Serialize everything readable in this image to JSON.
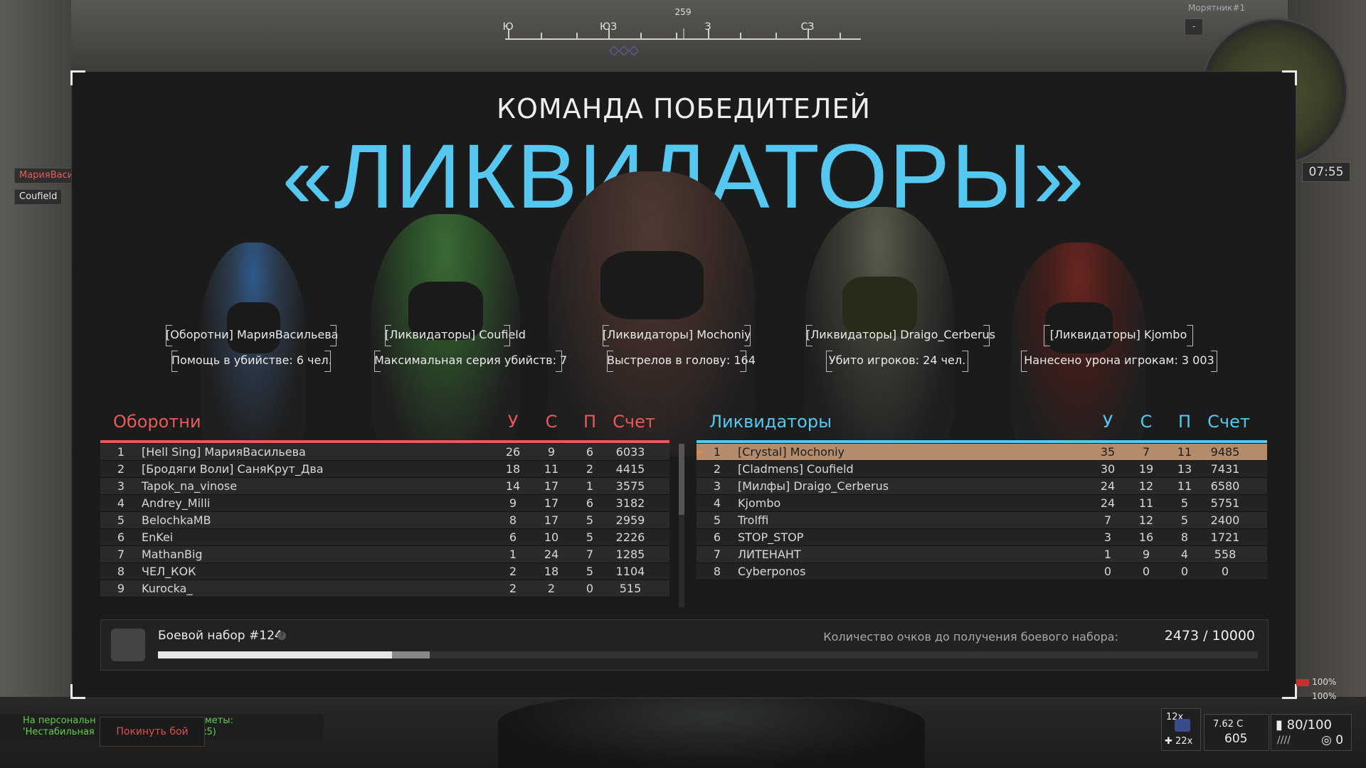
{
  "compass": {
    "labels": [
      "Ю",
      "ЮЗ",
      "З",
      "СЗ"
    ],
    "heading": "259"
  },
  "minimap": {
    "player": "Морятник#1",
    "btn": "-"
  },
  "timer": "07:55",
  "left_tags": [
    "МарияВаси",
    "Coufield"
  ],
  "winner": {
    "subtitle": "КОМАНДА ПОБЕДИТЕЛЕЙ",
    "name": "«ЛИКВИДАТОРЫ»"
  },
  "mvps": [
    {
      "name": "[Оборотни] МарияВасильева",
      "award": "Помощь в убийстве: 6 чел."
    },
    {
      "name": "[Ликвидаторы] Coufield",
      "award": "Максимальная серия убийств: 7"
    },
    {
      "name": "[Ликвидаторы] Mochoniy",
      "award": "Выстрелов в голову: 164"
    },
    {
      "name": "[Ликвидаторы] Draigo_Cerberus",
      "award": "Убито игроков: 24 чел."
    },
    {
      "name": "[Ликвидаторы] Kjombo",
      "award": "Нанесено урона игрокам: 3 003"
    }
  ],
  "headers": {
    "u": "У",
    "s": "С",
    "p": "П",
    "score": "Счет"
  },
  "team_left": {
    "name": "Оборотни",
    "color": "#e85a5a",
    "rows": [
      {
        "n": "1",
        "name": "[Hell Sing] МарияВасильева",
        "u": "26",
        "s": "9",
        "p": "6",
        "score": "6033"
      },
      {
        "n": "2",
        "name": "[Бродяги Воли] СаняКрут_Два",
        "u": "18",
        "s": "11",
        "p": "2",
        "score": "4415"
      },
      {
        "n": "3",
        "name": "Tapok_na_vinose",
        "u": "14",
        "s": "17",
        "p": "1",
        "score": "3575"
      },
      {
        "n": "4",
        "name": "Andrey_Milli",
        "u": "9",
        "s": "17",
        "p": "6",
        "score": "3182"
      },
      {
        "n": "5",
        "name": "BelochkaMB",
        "u": "8",
        "s": "17",
        "p": "5",
        "score": "2959"
      },
      {
        "n": "6",
        "name": "EnKei",
        "u": "6",
        "s": "10",
        "p": "5",
        "score": "2226"
      },
      {
        "n": "7",
        "name": "MathanBig",
        "u": "1",
        "s": "24",
        "p": "7",
        "score": "1285"
      },
      {
        "n": "8",
        "name": "ЧЕЛ_КОК",
        "u": "2",
        "s": "18",
        "p": "5",
        "score": "1104"
      },
      {
        "n": "9",
        "name": "Kurocka_",
        "u": "2",
        "s": "2",
        "p": "0",
        "score": "515"
      }
    ]
  },
  "team_right": {
    "name": "Ликвидаторы",
    "color": "#56c8f0",
    "rows": [
      {
        "n": "1",
        "name": "[Crystal] Mochoniy",
        "u": "35",
        "s": "7",
        "p": "11",
        "score": "9485"
      },
      {
        "n": "2",
        "name": "[Cladmens] Coufield",
        "u": "30",
        "s": "19",
        "p": "13",
        "score": "7431"
      },
      {
        "n": "3",
        "name": "[Милфы] Draigo_Cerberus",
        "u": "24",
        "s": "12",
        "p": "11",
        "score": "6580"
      },
      {
        "n": "4",
        "name": "Kjombo",
        "u": "24",
        "s": "11",
        "p": "5",
        "score": "5751"
      },
      {
        "n": "5",
        "name": "Trolffi",
        "u": "7",
        "s": "12",
        "p": "5",
        "score": "2400"
      },
      {
        "n": "6",
        "name": "STOP_STOP",
        "u": "3",
        "s": "16",
        "p": "8",
        "score": "1721"
      },
      {
        "n": "7",
        "name": "ЛИТЕНАНТ",
        "u": "1",
        "s": "9",
        "p": "4",
        "score": "558"
      },
      {
        "n": "8",
        "name": "Cyberponos",
        "u": "0",
        "s": "0",
        "p": "0",
        "score": "0"
      }
    ]
  },
  "kit": {
    "title": "Боевой набор #124",
    "info_icon": "?",
    "label": "Количество очков до получения боевого набора:",
    "value": "2473 / 10000",
    "progress": 0.2473
  },
  "chat": {
    "line1": "На персональн",
    "line1b": "редметы:",
    "line2": "'Нестабильная",
    "line2b": "x5)"
  },
  "leave_button": "Покинуть бой",
  "hud": {
    "armor": "100%",
    "health": "100%",
    "grenades_top": "12x",
    "grenades_bottom": "22x",
    "caliber": "7.62 C",
    "ammo_reserve": "605",
    "hp": "80/100",
    "extra": "0"
  }
}
